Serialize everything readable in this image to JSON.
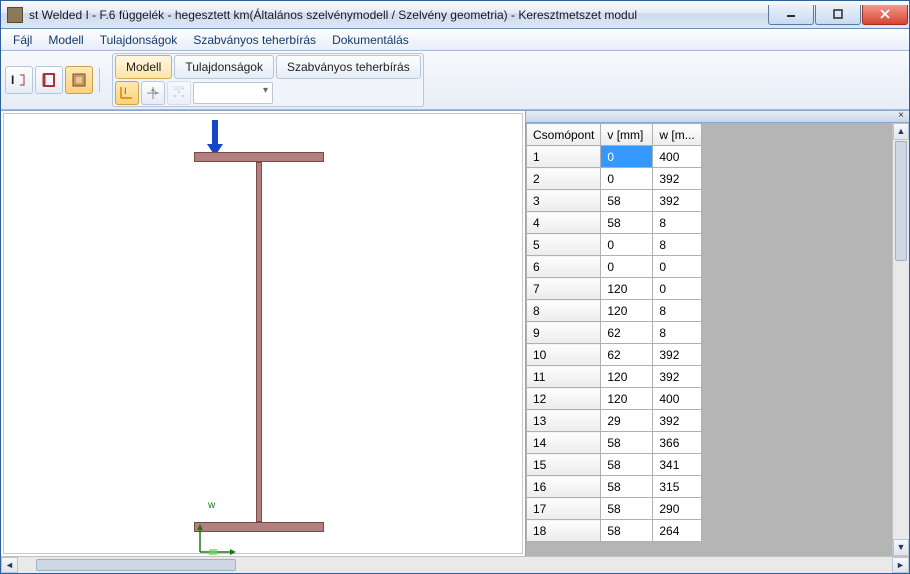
{
  "window": {
    "title": "st Welded I - F.6 függelék - hegesztett km(Általános szelvénymodell / Szelvény geometria) - Keresztmetszet modul"
  },
  "menu": {
    "file": "Fájl",
    "model": "Modell",
    "properties": "Tulajdonságok",
    "standard": "Szabványos teherbírás",
    "doc": "Dokumentálás"
  },
  "tabs": {
    "model": "Modell",
    "properties": "Tulajdonságok",
    "standard": "Szabványos teherbírás"
  },
  "axis_label": "w",
  "table": {
    "headers": {
      "node": "Csomópont",
      "v": "v [mm]",
      "w": "w [m..."
    },
    "rows": [
      {
        "i": "1",
        "v": "0",
        "w": "400"
      },
      {
        "i": "2",
        "v": "0",
        "w": "392"
      },
      {
        "i": "3",
        "v": "58",
        "w": "392"
      },
      {
        "i": "4",
        "v": "58",
        "w": "8"
      },
      {
        "i": "5",
        "v": "0",
        "w": "8"
      },
      {
        "i": "6",
        "v": "0",
        "w": "0"
      },
      {
        "i": "7",
        "v": "120",
        "w": "0"
      },
      {
        "i": "8",
        "v": "120",
        "w": "8"
      },
      {
        "i": "9",
        "v": "62",
        "w": "8"
      },
      {
        "i": "10",
        "v": "62",
        "w": "392"
      },
      {
        "i": "11",
        "v": "120",
        "w": "392"
      },
      {
        "i": "12",
        "v": "120",
        "w": "400"
      },
      {
        "i": "13",
        "v": "29",
        "w": "392"
      },
      {
        "i": "14",
        "v": "58",
        "w": "366"
      },
      {
        "i": "15",
        "v": "58",
        "w": "341"
      },
      {
        "i": "16",
        "v": "58",
        "w": "315"
      },
      {
        "i": "17",
        "v": "58",
        "w": "290"
      },
      {
        "i": "18",
        "v": "58",
        "w": "264"
      }
    ],
    "selected_cell": {
      "row": 0,
      "col": "v"
    }
  }
}
